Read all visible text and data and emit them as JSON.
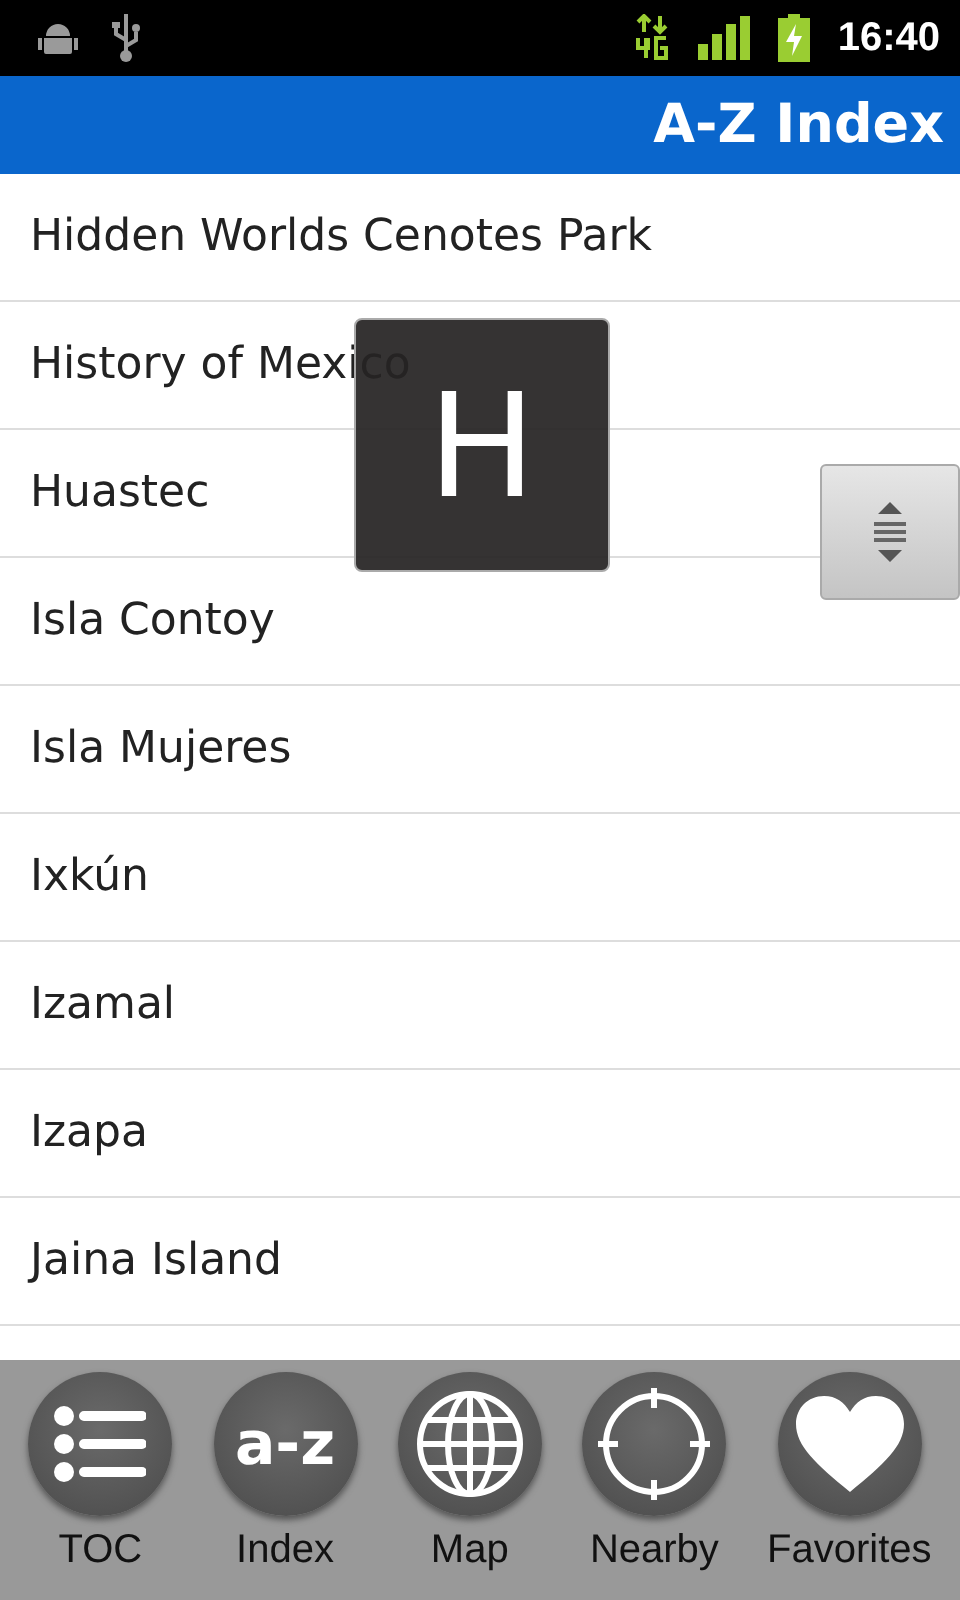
{
  "status_bar": {
    "time": "16:40"
  },
  "header": {
    "title": "A-Z Index"
  },
  "index_list": {
    "items": [
      {
        "label": "Hidden Worlds Cenotes Park"
      },
      {
        "label": "History of Mexico"
      },
      {
        "label": "Huastec"
      },
      {
        "label": "Isla Contoy"
      },
      {
        "label": "Isla Mujeres"
      },
      {
        "label": "Ixkún"
      },
      {
        "label": "Izamal"
      },
      {
        "label": "Izapa"
      },
      {
        "label": "Jaina Island"
      }
    ]
  },
  "letter_overlay": {
    "letter": "H"
  },
  "tab_bar": {
    "items": [
      {
        "kind": "toc",
        "label": "TOC"
      },
      {
        "kind": "index",
        "label": "Index",
        "icon_text": "a-z"
      },
      {
        "kind": "map",
        "label": "Map"
      },
      {
        "kind": "nearby",
        "label": "Nearby"
      },
      {
        "kind": "favorites",
        "label": "Favorites"
      }
    ]
  }
}
